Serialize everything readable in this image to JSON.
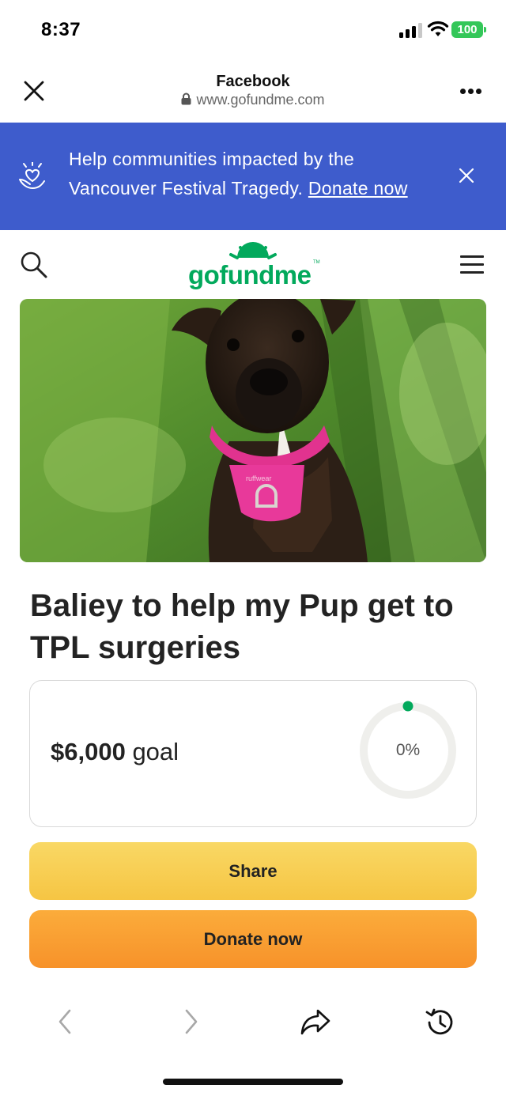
{
  "status_bar": {
    "time": "8:37",
    "battery": "100",
    "signal_icon": "cellular-signal-icon",
    "wifi_icon": "wifi-icon"
  },
  "browser": {
    "title": "Facebook",
    "url": "www.gofundme.com",
    "close_icon": "close-icon",
    "more_icon": "more-options-icon"
  },
  "banner": {
    "text": "Help communities impacted by the Vancouver Festival Tragedy. ",
    "link": "Donate now",
    "icon": "heart-hands-icon",
    "bg_color": "#3e5ccc"
  },
  "site_header": {
    "logo": "gofundme",
    "logo_tm": "TM",
    "search_icon": "search-icon",
    "menu_icon": "hamburger-menu-icon",
    "brand_color": "#02a95c"
  },
  "hero": {
    "photo_tag": "ruffwear"
  },
  "campaign": {
    "title": "Baliey to help my Pup get to TPL surgeries",
    "goal_amount": "$6,000",
    "goal_suffix": " goal",
    "progress_text": "0%",
    "progress_fraction": 0
  },
  "actions": {
    "share": "Share",
    "donate": "Donate now"
  },
  "toolbar": {
    "back_icon": "back-arrow-icon",
    "forward_icon": "forward-arrow-icon",
    "share_icon": "share-arrow-icon",
    "history_icon": "history-icon"
  }
}
